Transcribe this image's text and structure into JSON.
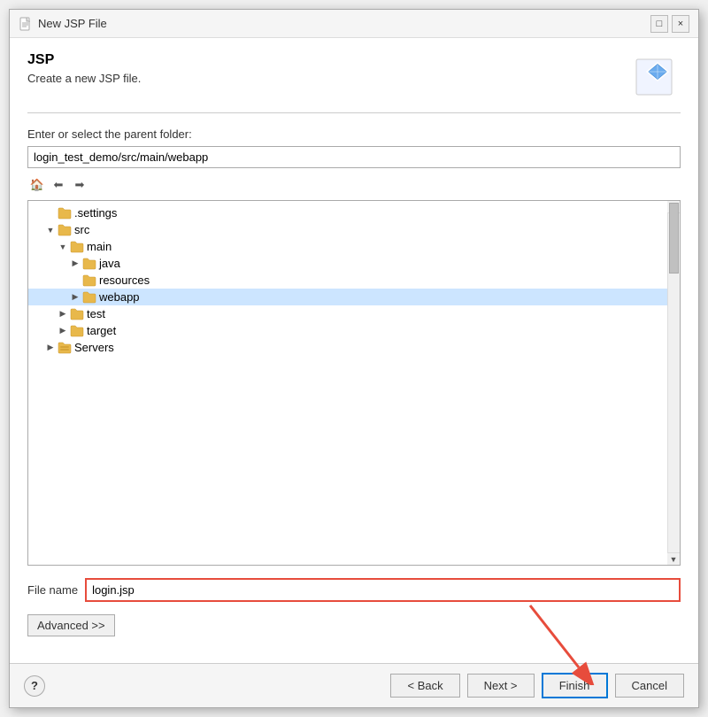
{
  "titleBar": {
    "title": "New JSP File",
    "icon": "file-icon",
    "minimize": "□",
    "close": "×"
  },
  "header": {
    "title": "JSP",
    "subtitle": "Create a new JSP file."
  },
  "folderSection": {
    "label": "Enter or select the parent folder:",
    "pathValue": "login_test_demo/src/main/webapp"
  },
  "tree": {
    "items": [
      {
        "id": 1,
        "label": ".settings",
        "indent": 1,
        "toggle": "",
        "selected": false
      },
      {
        "id": 2,
        "label": "src",
        "indent": 1,
        "toggle": "▼",
        "selected": false
      },
      {
        "id": 3,
        "label": "main",
        "indent": 2,
        "toggle": "▼",
        "selected": false
      },
      {
        "id": 4,
        "label": "java",
        "indent": 3,
        "toggle": ">",
        "selected": false
      },
      {
        "id": 5,
        "label": "resources",
        "indent": 3,
        "toggle": "",
        "selected": false
      },
      {
        "id": 6,
        "label": "webapp",
        "indent": 3,
        "toggle": ">",
        "selected": true
      },
      {
        "id": 7,
        "label": "test",
        "indent": 2,
        "toggle": ">",
        "selected": false
      },
      {
        "id": 8,
        "label": "target",
        "indent": 2,
        "toggle": ">",
        "selected": false
      },
      {
        "id": 9,
        "label": "Servers",
        "indent": 1,
        "toggle": ">",
        "selected": false
      }
    ]
  },
  "fileNameSection": {
    "label": "File name",
    "value": "login.jsp"
  },
  "advancedBtn": "Advanced >>",
  "buttons": {
    "help": "?",
    "back": "< Back",
    "next": "Next >",
    "finish": "Finish",
    "cancel": "Cancel"
  }
}
